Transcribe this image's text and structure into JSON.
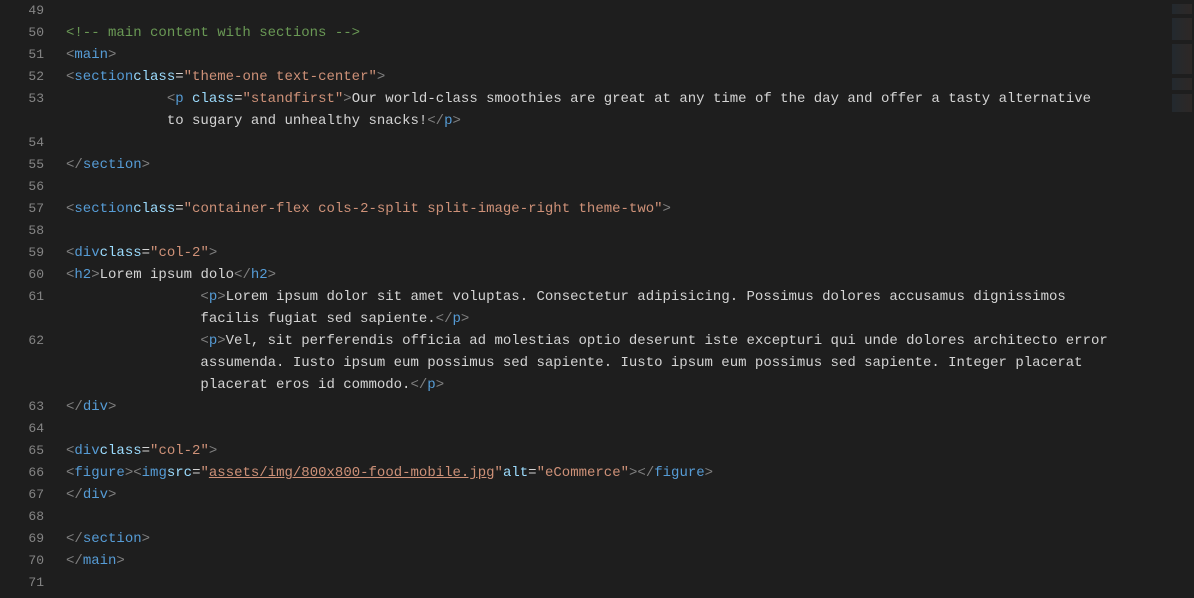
{
  "lines": {
    "start": 49,
    "numbers": [
      "49",
      "50",
      "51",
      "52",
      "53",
      "",
      "54",
      "55",
      "56",
      "57",
      "58",
      "59",
      "60",
      "61",
      "",
      "62",
      "",
      "",
      "63",
      "64",
      "65",
      "66",
      "67",
      "68",
      "69",
      "70",
      "71"
    ]
  },
  "code": {
    "comment": "<!-- main content with sections -->",
    "main_open": "main",
    "main_close": "main",
    "section1_open_tag": "section",
    "section1_class": "theme-one text-center",
    "p1_tag": "p",
    "p1_class": "standfirst",
    "p1_text": "Our world-class smoothies are great at any time of the day and offer a tasty alternative to sugary and unhealthy snacks!",
    "section1_close": "section",
    "section2_open_tag": "section",
    "section2_class": "container-flex cols-2-split split-image-right theme-two",
    "div1_tag": "div",
    "div1_class": "col-2",
    "h2_tag": "h2",
    "h2_text": "Lorem ipsum dolo",
    "p2_tag": "p",
    "p2_text": "Lorem ipsum dolor sit amet voluptas. Consectetur adipisicing. Possimus dolores accusamus dignissimos facilis fugiat sed sapiente.",
    "p3_tag": "p",
    "p3_text": "Vel, sit perferendis officia ad molestias optio deserunt iste excepturi qui unde dolores architecto error assumenda. Iusto ipsum eum possimus sed sapiente. Iusto ipsum eum possimus sed sapiente. Integer placerat placerat eros id commodo.",
    "div_close": "div",
    "div2_tag": "div",
    "div2_class": "col-2",
    "figure_tag": "figure",
    "img_tag": "img",
    "img_src": "assets/img/800x800-food-mobile.jpg",
    "img_alt": "eCommerce",
    "section2_close": "section",
    "attr_class": "class",
    "attr_src": "src",
    "attr_alt": "alt"
  }
}
